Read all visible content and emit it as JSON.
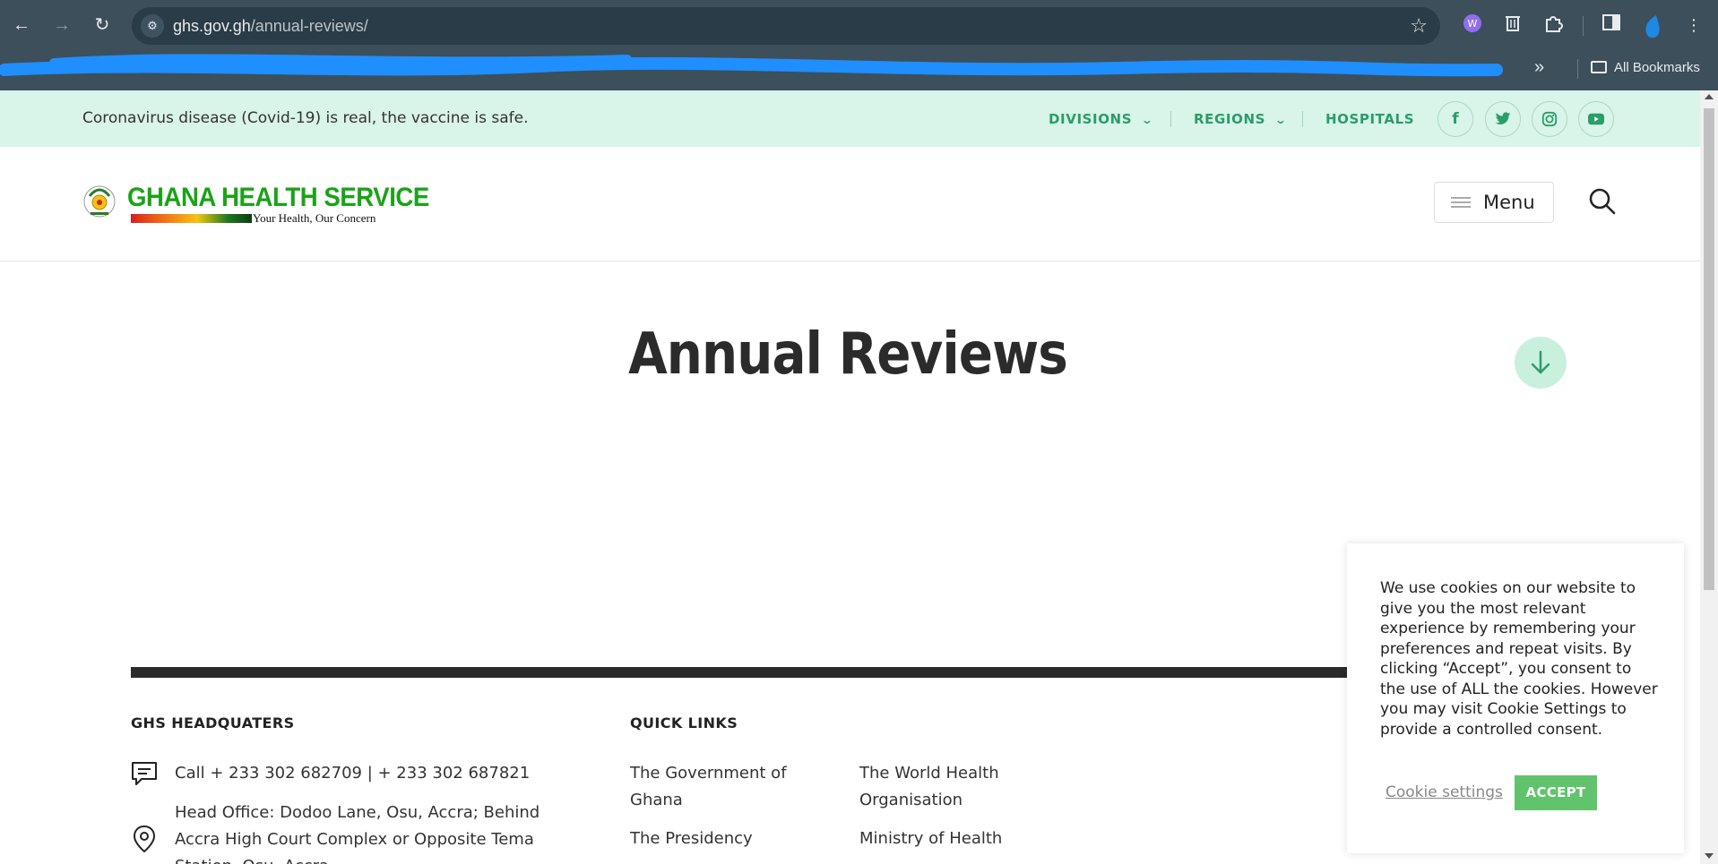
{
  "browser": {
    "url_host": "ghs.gov.gh",
    "url_path": "/annual-reviews/",
    "back_icon": "arrow-left",
    "forward_icon": "arrow-right",
    "reload_icon": "reload",
    "all_bookmarks_label": "All Bookmarks"
  },
  "topbar": {
    "notice": "Coronavirus disease (Covid-19) is real, the vaccine is safe.",
    "nav": [
      {
        "label": "DIVISIONS"
      },
      {
        "label": "REGIONS"
      },
      {
        "label": "HOSPITALS"
      }
    ],
    "social": [
      "f",
      "t",
      "ig",
      "yt"
    ]
  },
  "header": {
    "logo_title": "GHANA HEALTH SERVICE",
    "logo_tagline": "Your Health, Our Concern",
    "menu_label": "Menu"
  },
  "main": {
    "title": "Annual Reviews"
  },
  "footer": {
    "hq_heading": "GHS HEADQUATERS",
    "phone": "Call + 233 302 682709 | + 233 302 687821",
    "address_lines": [
      "Head Office: Dodoo Lane, Osu, Accra; Behind",
      "Accra High Court Complex or Opposite Tema",
      "Station, Osu, Accra"
    ],
    "quick_links_heading": "QUICK LINKS",
    "links_col1": [
      {
        "line1": "The Government of",
        "line2": "Ghana"
      },
      {
        "line1": "The Presidency",
        "line2": ""
      }
    ],
    "links_col2": [
      {
        "line1": "The World Health",
        "line2": "Organisation"
      },
      {
        "line1": "Ministry of Health",
        "line2": ""
      }
    ]
  },
  "cookie": {
    "text": "We use cookies on our website to give you the most relevant experience by remembering your preferences and repeat visits. By clicking “Accept”, you consent to the use of ALL the cookies. However you may visit Cookie Settings to provide a controlled consent.",
    "settings_label": "Cookie settings",
    "accept_label": "ACCEPT"
  },
  "colors": {
    "accent": "#2a9d6a",
    "topbar_bg": "#d9f4e8",
    "accept_bg": "#61c36b",
    "chrome_bg": "#3c4f5b"
  }
}
